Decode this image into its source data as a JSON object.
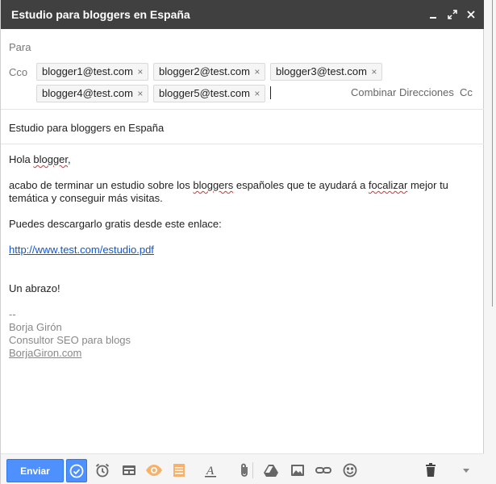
{
  "window": {
    "title": "Estudio para bloggers en España"
  },
  "recipients": {
    "to_label": "Para",
    "bcc_label": "Cco",
    "bcc": [
      "blogger1@test.com",
      "blogger2@test.com",
      "blogger3@test.com",
      "blogger4@test.com",
      "blogger5@test.com"
    ],
    "remove_glyph": "×",
    "combine_label": "Combinar Direcciones",
    "cc_label": "Cc"
  },
  "subject": {
    "value": "Estudio para bloggers en España"
  },
  "body": {
    "greeting_pre": "Hola ",
    "greeting_word": "blogger",
    "greeting_post": ",",
    "p1_a": "acabo de terminar un estudio sobre los ",
    "p1_w1": "bloggers",
    "p1_b": " españoles que te ayudará a ",
    "p1_w2": "focalizar",
    "p1_c": " mejor tu temática y conseguir más visitas.",
    "p2": "Puedes descargarlo gratis desde este enlace:",
    "link": "http://www.test.com/estudio.pdf",
    "closing": "Un abrazo!",
    "sig_dash": "--",
    "sig_name": "Borja Girón",
    "sig_role": "Consultor SEO para blogs",
    "sig_site": "BorjaGiron.com"
  },
  "toolbar": {
    "send_label": "Enviar",
    "icons": [
      "schedule-check-icon",
      "alarm-clock-icon",
      "template-icon",
      "eye-tracking-icon",
      "notes-icon",
      "text-format-icon",
      "attach-icon",
      "drive-icon",
      "insert-photo-icon",
      "insert-link-icon",
      "emoji-icon",
      "trash-icon",
      "more-options-icon"
    ]
  },
  "colors": {
    "titlebar": "#404040",
    "send": "#4d90fe",
    "link": "#1155cc",
    "tracking_accent": "#f6b26b"
  }
}
